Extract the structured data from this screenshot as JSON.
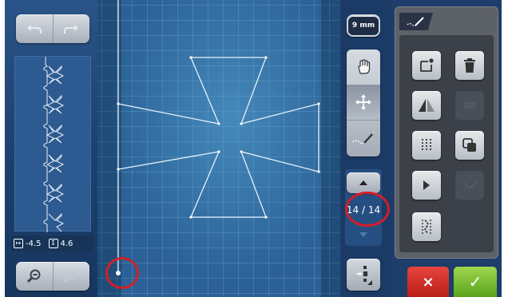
{
  "left_panel": {
    "offset_x": "-4.5",
    "offset_y": "4.6"
  },
  "right_column": {
    "stitch_length": "9 mm",
    "stitch_counter": "14 / 14"
  },
  "right_panel": {
    "cancel_label": "×",
    "confirm_label": "✓"
  },
  "icons": [
    "undo-icon",
    "redo-icon",
    "zoom-out-icon",
    "zoom-in-icon",
    "hand-pan-icon",
    "move-arrows-icon",
    "stitch-tool-icon",
    "arrow-up-icon",
    "arrow-down-icon",
    "needle-position-icon",
    "stitch-type-icon",
    "insert-point-icon",
    "delete-icon",
    "mirror-icon",
    "align-icon",
    "repeat-icon",
    "duplicate-icon",
    "play-icon",
    "reverse-icon",
    "triple-stitch-icon"
  ],
  "colors": {
    "cancel": "#c92a22",
    "confirm": "#74b92c",
    "highlight_ring": "#d31f26",
    "stitch_line": "#e6f2fa"
  }
}
